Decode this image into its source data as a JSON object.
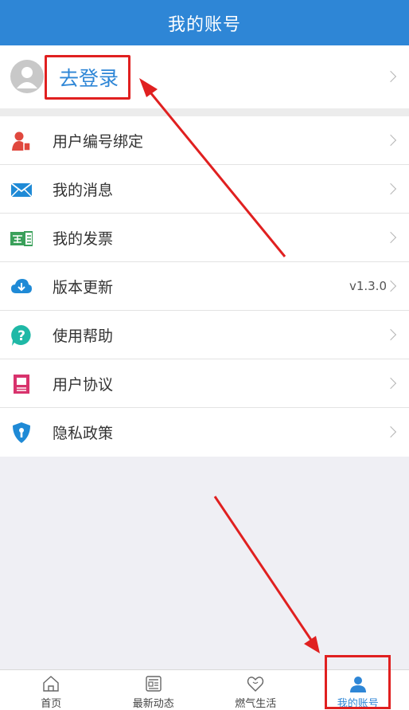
{
  "header": {
    "title": "我的账号"
  },
  "login": {
    "label": "去登录"
  },
  "menu": {
    "items": [
      {
        "label": "用户编号绑定",
        "value": ""
      },
      {
        "label": "我的消息",
        "value": ""
      },
      {
        "label": "我的发票",
        "value": ""
      },
      {
        "label": "版本更新",
        "value": "v1.3.0"
      },
      {
        "label": "使用帮助",
        "value": ""
      },
      {
        "label": "用户协议",
        "value": ""
      },
      {
        "label": "隐私政策",
        "value": ""
      }
    ]
  },
  "tabbar": {
    "tabs": [
      {
        "label": "首页"
      },
      {
        "label": "最新动态"
      },
      {
        "label": "燃气生活"
      },
      {
        "label": "我的账号"
      }
    ]
  },
  "colors": {
    "brand": "#2e86d6",
    "annotation": "#e02020"
  },
  "icons": [
    "user-avatar-icon",
    "user-binding-icon",
    "mail-icon",
    "invoice-icon",
    "cloud-download-icon",
    "help-icon",
    "agreement-icon",
    "privacy-shield-icon",
    "home-icon",
    "news-icon",
    "heart-life-icon",
    "person-icon"
  ]
}
